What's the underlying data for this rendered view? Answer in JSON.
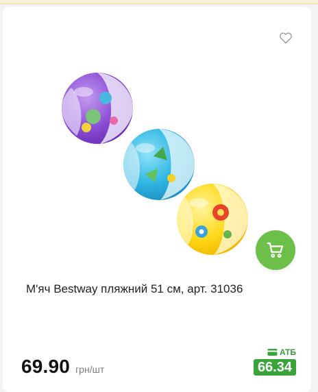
{
  "product": {
    "title": "М'яч Bestway пляжний 51 см, арт. 31036",
    "price": "69.90",
    "unit": "грн/шт",
    "atb_label": "АТБ",
    "atb_price": "66.34"
  },
  "icons": {
    "favorite": "heart-outline-icon",
    "cart": "shopping-cart-icon",
    "card": "wallet-card-icon"
  },
  "colors": {
    "accent_green": "#6cc04a",
    "atb_green": "#3aa43a",
    "top_strip": "#f1d88a"
  }
}
